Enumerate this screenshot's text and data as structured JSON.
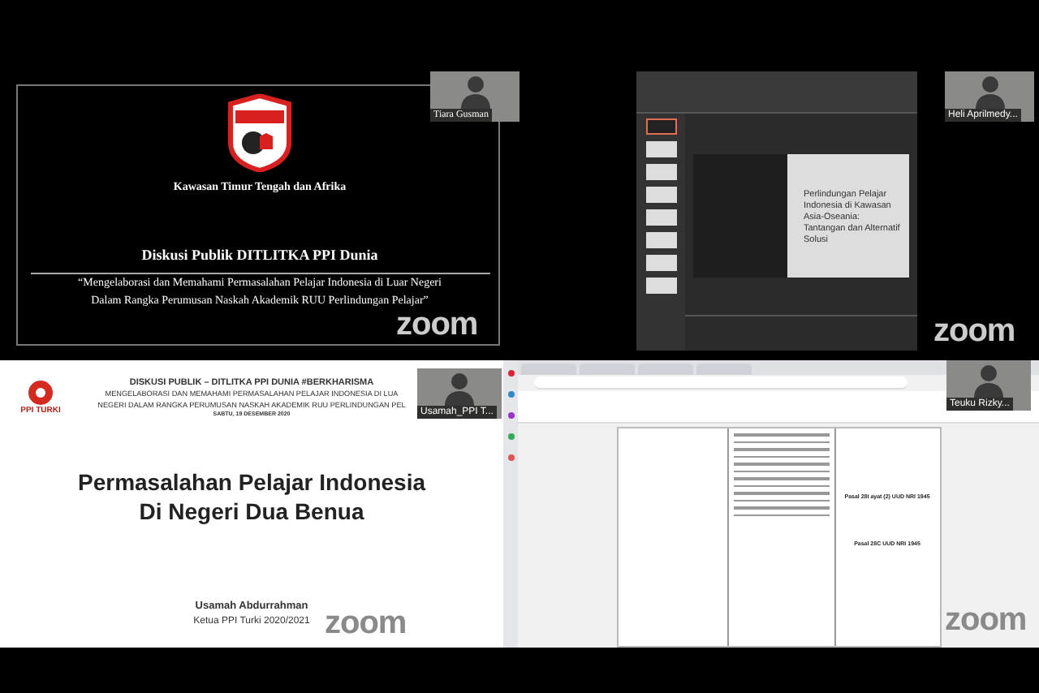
{
  "tiles": [
    {
      "kind": "title_slide",
      "participant": "Tiara Gusman",
      "caption": "Kawasan Timur Tengah dan Afrika",
      "title": "Diskusi Publik DITLITKA PPI Dunia",
      "quote_lines": [
        "“Mengelaborasi dan Memahami Permasalahan Pelajar Indonesia di Luar Negeri",
        "Dalam Rangka Perumusan Naskah Akademik RUU Perlindungan Pelajar”"
      ],
      "brand": "zoom"
    },
    {
      "kind": "presentation_editor",
      "participant": "Heli Aprilmedy...",
      "slide_title": "Perlindungan Pelajar Indonesia di Kawasan Asia-Oseania: Tantangan dan Alternatif Solusi",
      "brand": "zoom"
    },
    {
      "kind": "lecture_slide",
      "participant": "Usamah_PPI T...",
      "logo_caption": "PPI TURKI",
      "header_lines": [
        "DISKUSI PUBLIK – DITLITKA PPI DUNIA #BERKHARISMA",
        "MENGELABORASI DAN MEMAHAMI PERMASALAHAN PELAJAR INDONESIA DI LUA",
        "NEGERI DALAM RANGKA PERUMUSAN NASKAH AKADEMIK RUU PERLINDUNGAN PEL",
        "SABTU, 19 DESEMBER 2020"
      ],
      "title_lines": [
        "Permasalahan Pelajar Indonesia",
        "Di Negeri Dua Benua"
      ],
      "speaker": "Usamah Abdurrahman",
      "role": "Ketua PPI Turki 2020/2021",
      "brand": "zoom"
    },
    {
      "kind": "document_browser",
      "participant": "Teuku Rizky...",
      "headings": [
        "Pasal 28I ayat (2) UUD NRI 1945",
        "Pasal 28C UUD NRI 1945"
      ],
      "brand": "zoom"
    }
  ]
}
